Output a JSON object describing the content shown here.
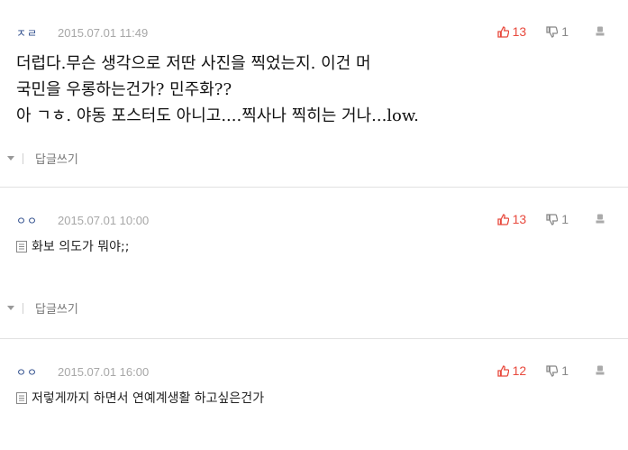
{
  "comments": [
    {
      "author": "ㅈㄹ",
      "date": "2015.07.01 11:49",
      "likes": "13",
      "dislikes": "1",
      "body": "더럽다.무슨 생각으로 저딴 사진을 찍었는지. 이건 머\n국민을 우롱하는건가? 민주화??\n아 ㄱㅎ. 야동 포스터도 아니고....찍사나 찍히는 거나...low.",
      "reply_label": "답글쓰기"
    },
    {
      "author": "ㅇㅇ",
      "date": "2015.07.01 10:00",
      "likes": "13",
      "dislikes": "1",
      "body": "화보 의도가 뭐야;;",
      "reply_label": "답글쓰기"
    },
    {
      "author": "ㅇㅇ",
      "date": "2015.07.01 16:00",
      "likes": "12",
      "dislikes": "1",
      "body": "저렇게까지 하면서 연예계생활 하고싶은건가"
    }
  ],
  "colors": {
    "like": "#e84a3e",
    "author": "#2b4a8a",
    "date": "#a7a7a7",
    "divider": "#e2e2e2"
  },
  "icons": {
    "like": "thumbs-up-icon",
    "dislike": "thumbs-down-icon",
    "more": "report-icon",
    "memo": "memo-icon",
    "reply": "triangle-down-icon"
  }
}
